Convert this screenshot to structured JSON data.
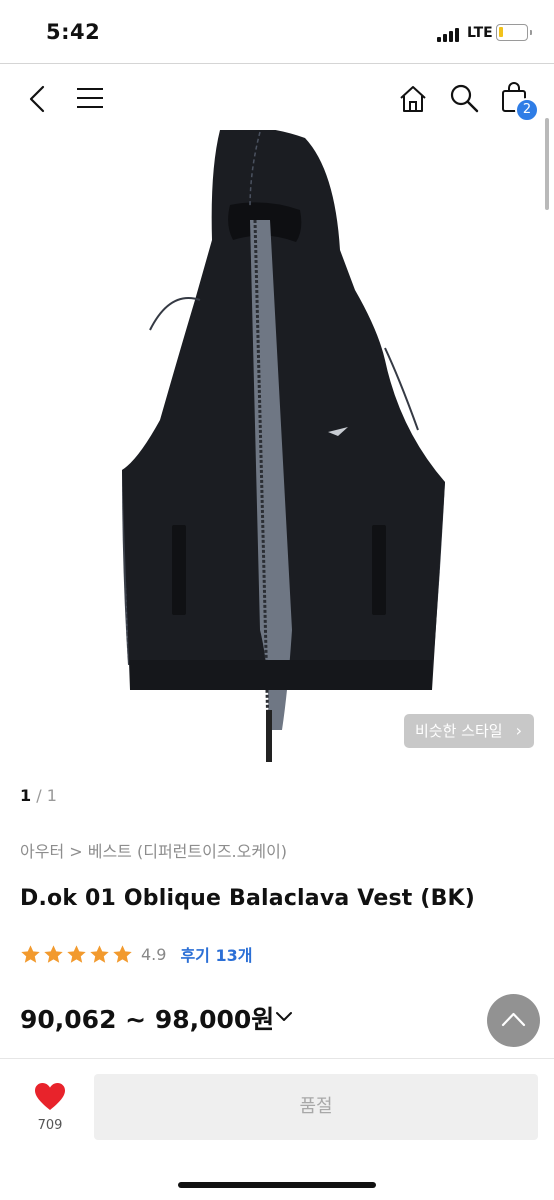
{
  "status_bar": {
    "time": "5:42",
    "network": "LTE",
    "battery_level": 0.12,
    "battery_color": "#f2c21b"
  },
  "nav": {
    "back_icon": "chevron-left-icon",
    "menu_icon": "hamburger-menu-icon",
    "home_icon": "home-icon",
    "search_icon": "search-icon",
    "cart_icon": "shopping-bag-icon",
    "cart_count": "2",
    "badge_color": "#2f7de6"
  },
  "product": {
    "image_counter": {
      "current": "1",
      "separator": "/",
      "total": "1"
    },
    "similar_style_label": "비슷한 스타일",
    "breadcrumb": "아우터 > 베스트 (디퍼런트이즈.오케이)",
    "title": "D.ok 01 Oblique Balaclava Vest (BK)",
    "rating": {
      "stars": 5,
      "score": "4.9",
      "reviews_label": "후기 13개",
      "star_color": "#f29a2e"
    },
    "price_range": "90,062 ~ 98,000원"
  },
  "bottom_bar": {
    "like_icon": "heart-icon",
    "like_count": "709",
    "like_color": "#e8232b",
    "soldout_label": "품절"
  },
  "scroll_top_icon": "chevron-up-icon"
}
